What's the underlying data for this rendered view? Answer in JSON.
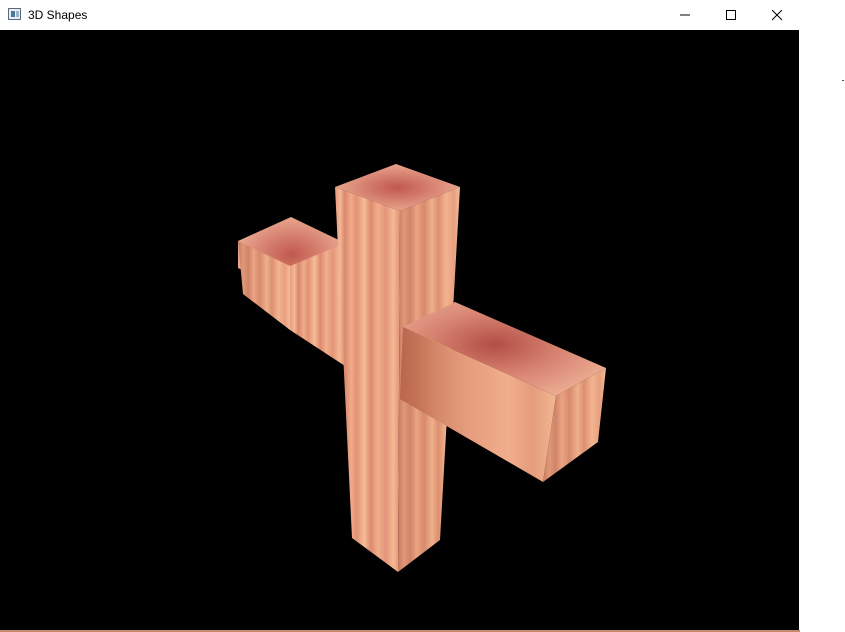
{
  "window": {
    "title": "3D Shapes",
    "icon": "application-window-icon",
    "controls": {
      "minimize": "minimize-icon",
      "maximize": "maximize-icon",
      "close": "close-icon"
    }
  },
  "scene": {
    "background_color": "#000000",
    "object": "wooden-cross",
    "material_colors": {
      "light": "#f5b894",
      "mid": "#e39a78",
      "dark": "#b8664e",
      "stain": "#b24e46"
    }
  }
}
